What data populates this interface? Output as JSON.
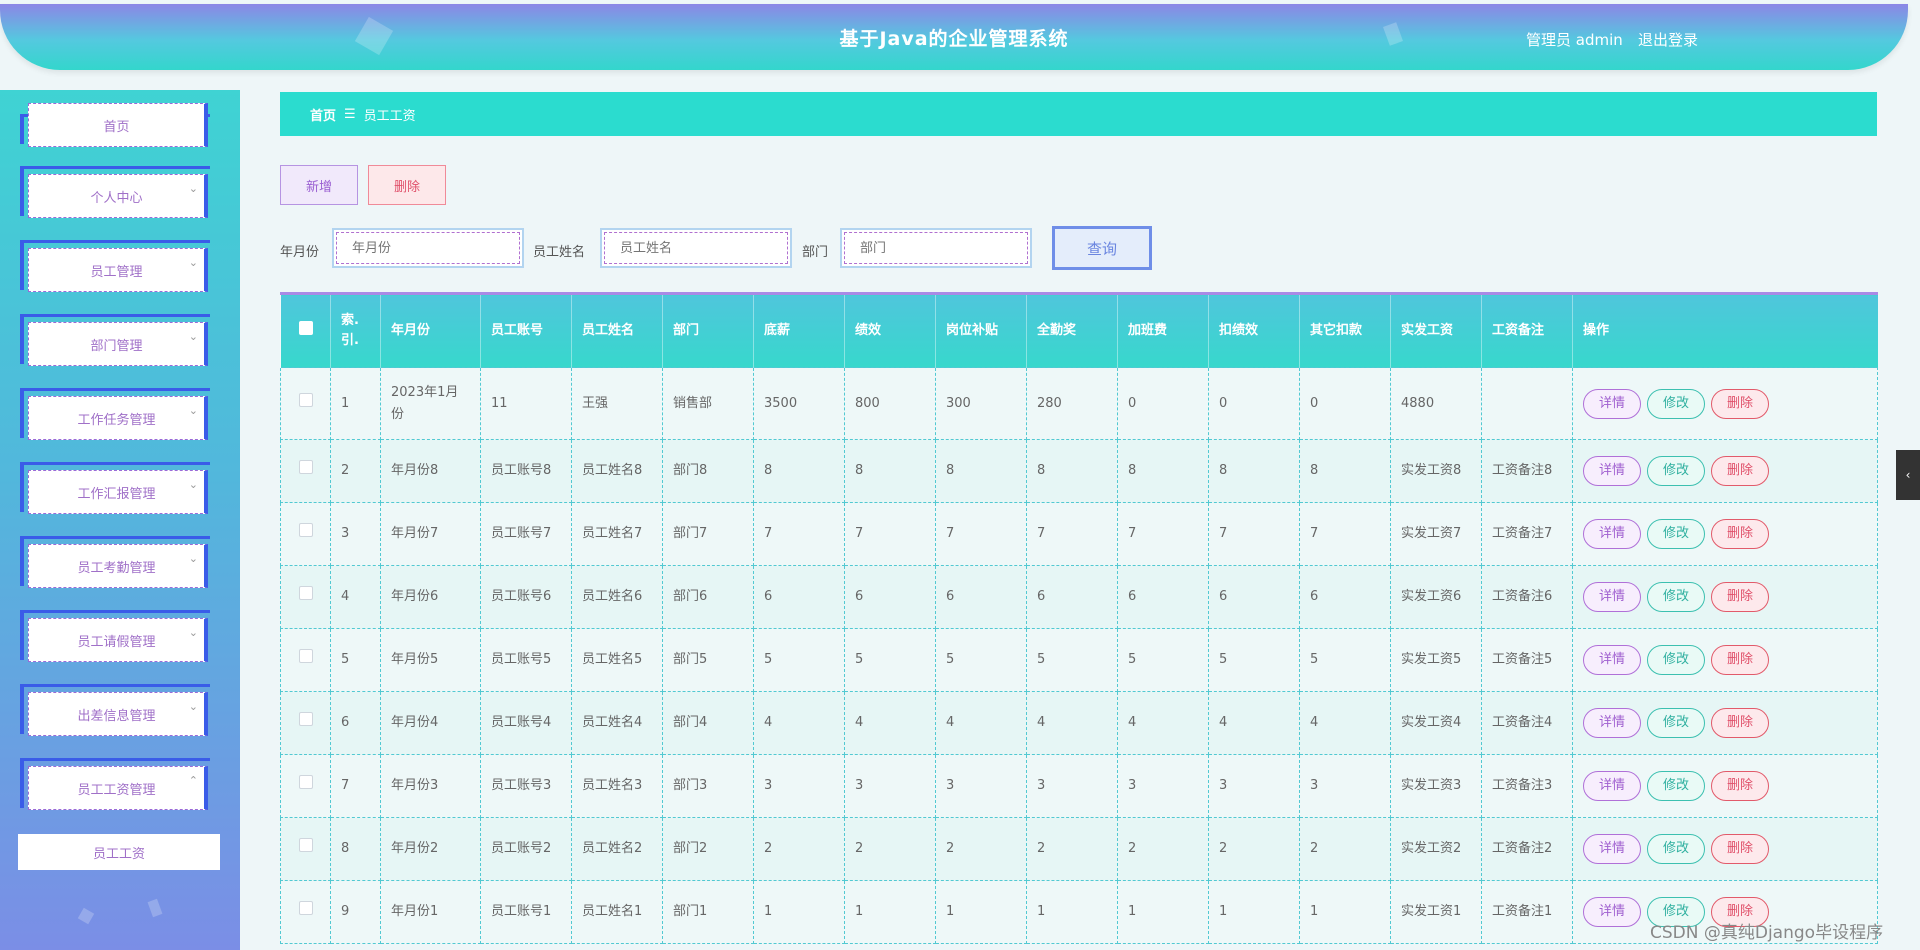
{
  "header": {
    "title": "基于Java的企业管理系统",
    "user": "管理员 admin",
    "logout": "退出登录"
  },
  "sidebar": {
    "items": [
      {
        "label": "首页",
        "chev": ""
      },
      {
        "label": "个人中心",
        "chev": "⌄"
      },
      {
        "label": "员工管理",
        "chev": "⌄"
      },
      {
        "label": "部门管理",
        "chev": "⌄"
      },
      {
        "label": "工作任务管理",
        "chev": "⌄"
      },
      {
        "label": "工作汇报管理",
        "chev": "⌄"
      },
      {
        "label": "员工考勤管理",
        "chev": "⌄"
      },
      {
        "label": "员工请假管理",
        "chev": "⌄"
      },
      {
        "label": "出差信息管理",
        "chev": "⌄"
      },
      {
        "label": "员工工资管理",
        "chev": "⌃"
      }
    ],
    "sub_item": "员工工资"
  },
  "breadcrumb": {
    "home": "首页",
    "sep": "☰",
    "current": "员工工资"
  },
  "toolbar": {
    "add": "新增",
    "delete": "删除"
  },
  "filters": {
    "month_label": "年月份",
    "month_placeholder": "年月份",
    "name_label": "员工姓名",
    "name_placeholder": "员工姓名",
    "dept_label": "部门",
    "dept_placeholder": "部门",
    "query": "查询"
  },
  "table": {
    "headers": [
      "索.引.",
      "年月份",
      "员工账号",
      "员工姓名",
      "部门",
      "底薪",
      "绩效",
      "岗位补贴",
      "全勤奖",
      "加班费",
      "扣绩效",
      "其它扣款",
      "实发工资",
      "工资备注",
      "操作"
    ],
    "actions": {
      "detail": "详情",
      "edit": "修改",
      "delete": "删除"
    },
    "rows": [
      [
        "1",
        "2023年1月份",
        "11",
        "王强",
        "销售部",
        "3500",
        "800",
        "300",
        "280",
        "0",
        "0",
        "0",
        "4880",
        ""
      ],
      [
        "2",
        "年月份8",
        "员工账号8",
        "员工姓名8",
        "部门8",
        "8",
        "8",
        "8",
        "8",
        "8",
        "8",
        "8",
        "实发工资8",
        "工资备注8"
      ],
      [
        "3",
        "年月份7",
        "员工账号7",
        "员工姓名7",
        "部门7",
        "7",
        "7",
        "7",
        "7",
        "7",
        "7",
        "7",
        "实发工资7",
        "工资备注7"
      ],
      [
        "4",
        "年月份6",
        "员工账号6",
        "员工姓名6",
        "部门6",
        "6",
        "6",
        "6",
        "6",
        "6",
        "6",
        "6",
        "实发工资6",
        "工资备注6"
      ],
      [
        "5",
        "年月份5",
        "员工账号5",
        "员工姓名5",
        "部门5",
        "5",
        "5",
        "5",
        "5",
        "5",
        "5",
        "5",
        "实发工资5",
        "工资备注5"
      ],
      [
        "6",
        "年月份4",
        "员工账号4",
        "员工姓名4",
        "部门4",
        "4",
        "4",
        "4",
        "4",
        "4",
        "4",
        "4",
        "实发工资4",
        "工资备注4"
      ],
      [
        "7",
        "年月份3",
        "员工账号3",
        "员工姓名3",
        "部门3",
        "3",
        "3",
        "3",
        "3",
        "3",
        "3",
        "3",
        "实发工资3",
        "工资备注3"
      ],
      [
        "8",
        "年月份2",
        "员工账号2",
        "员工姓名2",
        "部门2",
        "2",
        "2",
        "2",
        "2",
        "2",
        "2",
        "2",
        "实发工资2",
        "工资备注2"
      ],
      [
        "9",
        "年月份1",
        "员工账号1",
        "员工姓名1",
        "部门1",
        "1",
        "1",
        "1",
        "1",
        "1",
        "1",
        "1",
        "实发工资1",
        "工资备注1"
      ]
    ]
  },
  "side_tab": "‹",
  "watermark": "CSDN @真纯Django毕设程序"
}
